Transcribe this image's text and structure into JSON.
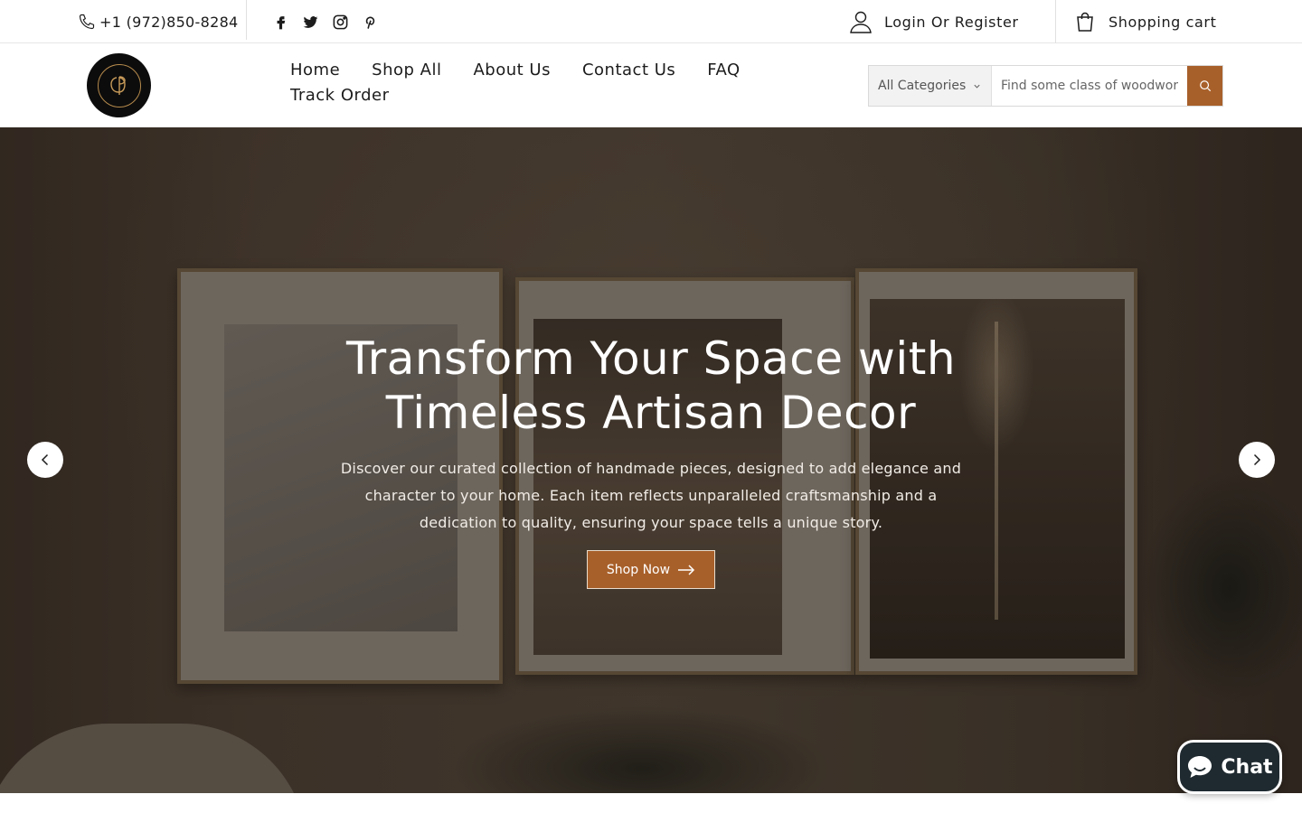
{
  "topbar": {
    "phone": "+1 (972)850-8284",
    "socials": [
      "facebook-icon",
      "twitter-icon",
      "instagram-icon",
      "pinterest-icon"
    ],
    "login_label": "Login Or Register",
    "cart_label": "Shopping cart"
  },
  "nav": {
    "items": [
      {
        "label": "Home"
      },
      {
        "label": "Shop All"
      },
      {
        "label": "About Us"
      },
      {
        "label": "Contact Us"
      },
      {
        "label": "FAQ"
      },
      {
        "label": "Track Order"
      }
    ]
  },
  "search": {
    "category_label": "All Categories",
    "placeholder": "Find some class of woodwork"
  },
  "hero": {
    "title": "Transform Your Space with Timeless Artisan Decor",
    "text": "Discover our curated collection of handmade pieces, designed to add elegance and character to your home. Each item reflects unparalleled craftsmanship and a dedication to quality, ensuring your space tells a unique story.",
    "button_label": "Shop Now"
  },
  "chat": {
    "label": "Chat"
  },
  "colors": {
    "accent": "#a8602a",
    "text": "#1c1c1c",
    "chat_bg": "#1f2a30"
  }
}
